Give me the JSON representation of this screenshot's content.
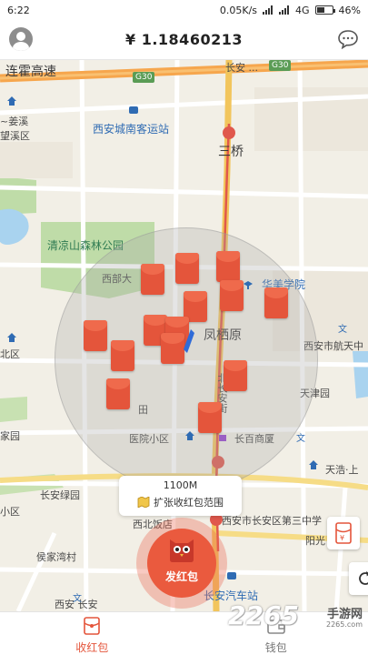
{
  "status_bar": {
    "time": "6:22",
    "net_speed": "0.05K/s",
    "network": "4G",
    "battery": "46%",
    "battery_level": 0.46
  },
  "header": {
    "balance": "¥ 1.18460213",
    "avatar_icon": "user-avatar-icon",
    "chat_icon": "message-bubble-icon"
  },
  "map": {
    "labels": {
      "expressway": "连霍高速",
      "shield_g30_a": "G30",
      "shield_g30_b": "G30",
      "road_top": "长安 ...",
      "district_jiangxi": "~姜溪",
      "district_wangxi": "望溪区",
      "bus_station": "西安城南客运站",
      "sanqiao": "三桥",
      "forest_park": "清凉山森林公园",
      "xibu": "西部大",
      "huamei": "华美学院",
      "fengqiyuan": "凤栖原",
      "hangtian": "西安市航天中",
      "tianjinyuan": "天津园",
      "tianhao": "天浩·上",
      "hospital": "医院小区",
      "changbai": "长百商厦",
      "changan_garden": "长安绿园",
      "xibei_hotel": "西北饭店",
      "middle_school": "西安市长安区第三中学",
      "yangguang": "阳光",
      "houjia": "侯家湾村",
      "bus_terminal": "长安汽车站",
      "left_area_1": "北区",
      "left_area_2": "家园",
      "xiaoqu": "小区",
      "fengqi_road": "丰镐路",
      "beichang": "北长安街",
      "xian_bottom": "西安 长安",
      "tian_edge": "田"
    }
  },
  "range_tip": {
    "distance": "1100M",
    "action_label": "扩张收红包范围",
    "action_icon": "map-fold-icon"
  },
  "send_button": {
    "label": "发红包",
    "icon": "owl-envelope-icon"
  },
  "side_buttons": {
    "wallet_icon": "red-envelope-yen-icon",
    "refresh_icon": "refresh-icon"
  },
  "tabbar": {
    "receive_label": "收红包",
    "wallet_label": "钱包",
    "receive_icon": "red-envelope-tab-icon",
    "wallet_icon": "wallet-tab-icon"
  },
  "watermark": {
    "number": "2265",
    "text": "手游网",
    "sub": "2265.com"
  },
  "colors": {
    "accent": "#e4553b",
    "highway": "#f6a64d",
    "water": "#a9d3ef",
    "park": "#bfdca8"
  }
}
